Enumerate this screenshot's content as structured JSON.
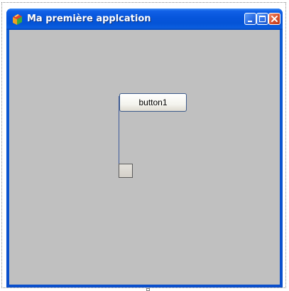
{
  "window": {
    "title": "Ma première applcation",
    "icon": "application-icon",
    "caption_buttons": {
      "minimize_icon": "minimize-icon",
      "maximize_icon": "maximize-icon",
      "close_icon": "close-icon"
    }
  },
  "form": {
    "background_color": "#c0c0c0",
    "button1_label": "button1",
    "checkbox_checked": false
  },
  "colors": {
    "titlebar_blue": "#0756dc",
    "close_red": "#d8502e",
    "client_gray": "#c0c0c0"
  }
}
